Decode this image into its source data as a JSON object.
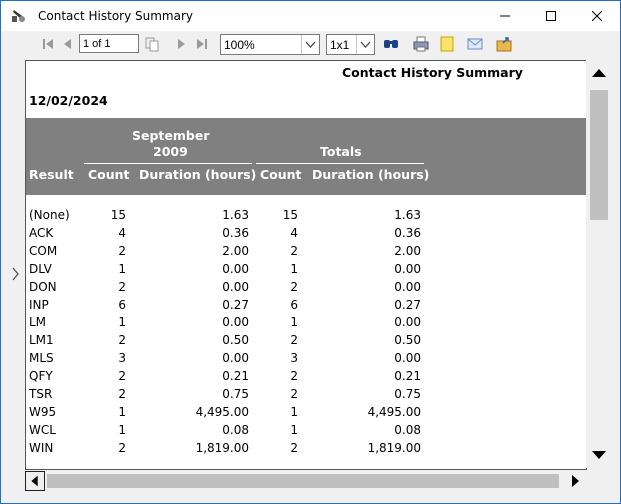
{
  "window": {
    "title": "Contact History Summary"
  },
  "toolbar": {
    "page_field": "1 of 1",
    "zoom": "100%",
    "layout": "1x1"
  },
  "report": {
    "title": "Contact History Summary",
    "date": "12/02/2024",
    "group_header_line1": "September",
    "group_header_line2": "2009",
    "totals_header": "Totals",
    "col_result": "Result",
    "col_count": "Count",
    "col_duration": "Duration (hours)",
    "rows": [
      {
        "result": "(None)",
        "count": "15",
        "duration": "1.63",
        "total_count": "15",
        "total_duration": "1.63"
      },
      {
        "result": "ACK",
        "count": "4",
        "duration": "0.36",
        "total_count": "4",
        "total_duration": "0.36"
      },
      {
        "result": "COM",
        "count": "2",
        "duration": "2.00",
        "total_count": "2",
        "total_duration": "2.00"
      },
      {
        "result": "DLV",
        "count": "1",
        "duration": "0.00",
        "total_count": "1",
        "total_duration": "0.00"
      },
      {
        "result": "DON",
        "count": "2",
        "duration": "0.00",
        "total_count": "2",
        "total_duration": "0.00"
      },
      {
        "result": "INP",
        "count": "6",
        "duration": "0.27",
        "total_count": "6",
        "total_duration": "0.27"
      },
      {
        "result": "LM",
        "count": "1",
        "duration": "0.00",
        "total_count": "1",
        "total_duration": "0.00"
      },
      {
        "result": "LM1",
        "count": "2",
        "duration": "0.50",
        "total_count": "2",
        "total_duration": "0.50"
      },
      {
        "result": "MLS",
        "count": "3",
        "duration": "0.00",
        "total_count": "3",
        "total_duration": "0.00"
      },
      {
        "result": "QFY",
        "count": "2",
        "duration": "0.21",
        "total_count": "2",
        "total_duration": "0.21"
      },
      {
        "result": "TSR",
        "count": "2",
        "duration": "0.75",
        "total_count": "2",
        "total_duration": "0.75"
      },
      {
        "result": "W95",
        "count": "1",
        "duration": "4,495.00",
        "total_count": "1",
        "total_duration": "4,495.00"
      },
      {
        "result": "WCL",
        "count": "1",
        "duration": "0.08",
        "total_count": "1",
        "total_duration": "0.08"
      },
      {
        "result": "WIN",
        "count": "2",
        "duration": "1,819.00",
        "total_count": "2",
        "total_duration": "1,819.00"
      }
    ]
  },
  "icons": [
    "app-icon",
    "first-page-icon",
    "prev-page-icon",
    "copy-page-icon",
    "next-page-icon",
    "last-page-icon",
    "find-icon",
    "print-icon",
    "note-icon",
    "email-icon",
    "export-icon",
    "minimize-icon",
    "maximize-icon",
    "close-icon"
  ]
}
